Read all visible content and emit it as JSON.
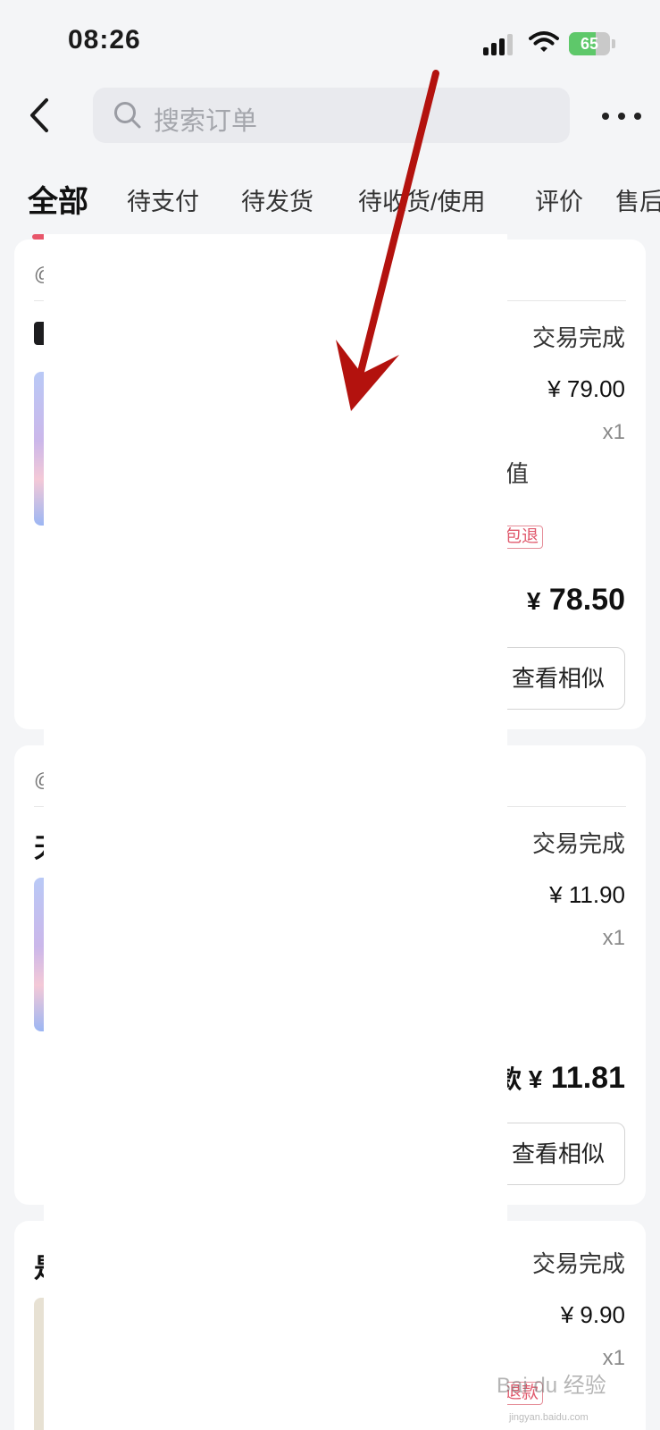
{
  "status_bar": {
    "time": "08:26",
    "battery": "65",
    "battery_level": 0.65
  },
  "search": {
    "placeholder": "搜索订单"
  },
  "tabs": [
    {
      "label": "全部",
      "active": true
    },
    {
      "label": "待支付"
    },
    {
      "label": "待发货"
    },
    {
      "label": "待收货/使用"
    },
    {
      "label": "评价"
    },
    {
      "label": "售后"
    }
  ],
  "orders": [
    {
      "status": "交易完成",
      "price": "¥ 79.00",
      "qty": "x1",
      "text_fragment": "值",
      "tag_fragment": "包退",
      "total_fragment": "¥",
      "total_amount": "78.50",
      "similar_label": "查看相似"
    },
    {
      "status": "交易完成",
      "price": "¥ 11.90",
      "qty": "x1",
      "total_fragment": "款 ¥",
      "total_amount": "11.81",
      "similar_label": "查看相似"
    },
    {
      "status": "交易完成",
      "price": "¥ 9.90",
      "qty": "x1",
      "tag_fragment": "退款"
    }
  ],
  "watermark": {
    "text": "Bai du 经验",
    "sub": "jingyan.baidu.com"
  },
  "colors": {
    "accent": "#e8566a",
    "arrow": "#b3120e",
    "page_bg": "#f4f5f7"
  }
}
